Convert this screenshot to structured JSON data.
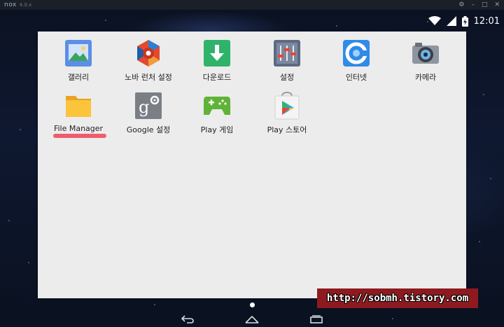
{
  "window": {
    "brand": "nox",
    "version": "4.0.x",
    "controls": [
      "⚙",
      "–",
      "□",
      "✕"
    ]
  },
  "status": {
    "time": "12:01"
  },
  "apps": [
    {
      "label": "갤러리",
      "icon": "gallery-icon"
    },
    {
      "label": "노바 런처 설정",
      "icon": "nova-launcher-icon"
    },
    {
      "label": "다운로드",
      "icon": "download-icon"
    },
    {
      "label": "설정",
      "icon": "settings-sliders-icon"
    },
    {
      "label": "인터넷",
      "icon": "browser-icon"
    },
    {
      "label": "카메라",
      "icon": "camera-icon"
    },
    {
      "label": "File Manager",
      "icon": "folder-icon"
    },
    {
      "label": "Google 설정",
      "icon": "google-settings-icon"
    },
    {
      "label": "Play 게임",
      "icon": "play-games-icon"
    },
    {
      "label": "Play 스토어",
      "icon": "play-store-icon"
    }
  ],
  "watermark": {
    "text": "http://sobmh.tistory.com"
  },
  "colors": {
    "drawer_bg": "#ececec",
    "highlight_underline": "#ee5d6c",
    "watermark_bg": "#8e1a20"
  }
}
